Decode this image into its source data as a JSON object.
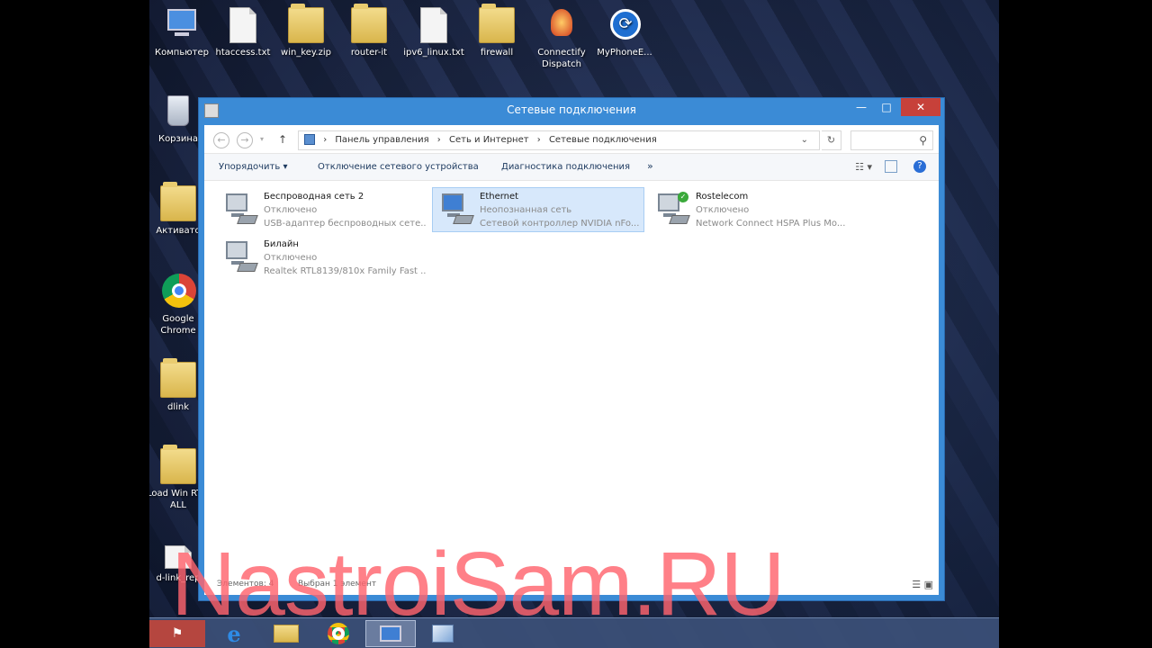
{
  "desktop": {
    "icons_top": [
      {
        "label": "Компьютер",
        "icon": "computer-icon"
      },
      {
        "label": "htaccess.txt",
        "icon": "text-file-icon"
      },
      {
        "label": "win_key.zip",
        "icon": "zip-folder-icon"
      },
      {
        "label": "router-it",
        "icon": "folder-icon"
      },
      {
        "label": "ipv6_linux.txt",
        "icon": "text-file-icon"
      },
      {
        "label": "firewall",
        "icon": "folder-icon"
      },
      {
        "label": "Connectify Dispatch",
        "icon": "connectify-icon"
      },
      {
        "label": "MyPhoneE...",
        "icon": "myphone-icon"
      }
    ],
    "icons_left": [
      {
        "label": "Корзина",
        "icon": "recycle-bin-icon"
      },
      {
        "label": "Активато",
        "icon": "folder-icon"
      },
      {
        "label": "Google Chrome",
        "icon": "chrome-icon"
      },
      {
        "label": "dlink",
        "icon": "folder-icon"
      },
      {
        "label": "Load Win RTM ALL",
        "icon": "folder-icon"
      },
      {
        "label": "d-link_rep",
        "icon": "text-file-icon"
      }
    ]
  },
  "window": {
    "title": "Сетевые подключения",
    "minimize": "—",
    "maximize": "□",
    "close": "✕",
    "breadcrumb": [
      "Панель управления",
      "Сеть и Интернет",
      "Сетевые подключения"
    ],
    "toolbar": {
      "organize": "Упорядочить ▾",
      "disable_device": "Отключение сетевого устройства",
      "diagnose": "Диагностика подключения",
      "more": "»"
    },
    "connections": [
      {
        "name": "Беспроводная сеть 2",
        "status": "Отключено",
        "device": "USB-адаптер беспроводных сете..."
      },
      {
        "name": "Ethernet",
        "status": "Неопознанная сеть",
        "device": "Сетевой контроллер NVIDIA nFo..."
      },
      {
        "name": "Rostelecom",
        "status": "Отключено",
        "device": "Network Connect HSPA Plus Mo..."
      },
      {
        "name": "Билайн",
        "status": "Отключено",
        "device": "Realtek RTL8139/810x Family Fast ..."
      }
    ],
    "statusbar": {
      "items": "Элементов: 4",
      "selected": "Выбран 1 элемент"
    }
  },
  "watermark": "NastroiSam.RU"
}
